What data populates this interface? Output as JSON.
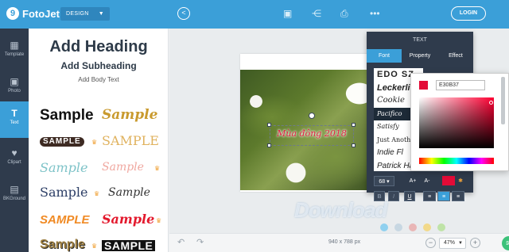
{
  "app": {
    "logo_text": "FotoJet",
    "logo_mark": "9",
    "design_dropdown": "DESIGN",
    "login_label": "LOGIN"
  },
  "sidebar": {
    "items": [
      {
        "label": "Template",
        "icon": "▦"
      },
      {
        "label": "Photo",
        "icon": "▣"
      },
      {
        "label": "Text",
        "icon": "T"
      },
      {
        "label": "Clipart",
        "icon": "♥"
      },
      {
        "label": "BKGround",
        "icon": "▤"
      }
    ]
  },
  "text_panel": {
    "heading": "Add Heading",
    "subheading": "Add Subheading",
    "body": "Add Body Text",
    "samples": [
      "Sample",
      "Sample",
      "SAMPLE",
      "SAMPLE",
      "Sample",
      "Sample",
      "Sample",
      "Sample",
      "SAMPLE",
      "Sample",
      "Sample",
      "SAMPLE"
    ]
  },
  "canvas": {
    "text_on_photo": "Mùa đông 2018"
  },
  "text_tool": {
    "title": "TEXT",
    "tabs": [
      "Font",
      "Property",
      "Effect"
    ],
    "fonts": [
      "EDO SZ",
      "Leckerli",
      "Cookie",
      "Pacifico",
      "Satisfy",
      "Just Another",
      "Indie Fl",
      "Patrick Han"
    ],
    "font_size": "68",
    "size_up": "A+",
    "size_down": "A-",
    "bold": "B",
    "italic": "I",
    "underline": "U",
    "text_color": "#E30B37"
  },
  "color_picker": {
    "hex_value": "E30B37"
  },
  "bottom_bar": {
    "dimensions": "940 x 788 px",
    "zoom": "47%"
  },
  "watermark": {
    "text": "Download"
  },
  "colors": {
    "accent": "#3b9fd8",
    "sidebar": "#2f3b4c",
    "selected_text": "#e30b37",
    "help": "#3cc27a"
  }
}
